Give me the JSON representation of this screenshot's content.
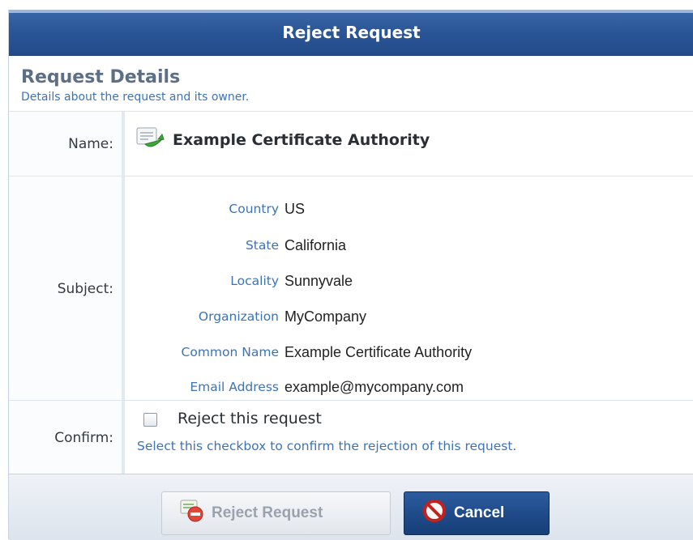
{
  "dialog": {
    "title": "Reject Request"
  },
  "section": {
    "title": "Request Details",
    "description": "Details about the request and its owner."
  },
  "name_row": {
    "label": "Name:",
    "icon": "certificate-icon",
    "value": "Example Certificate Authority"
  },
  "subject_row": {
    "label": "Subject:",
    "fields": [
      {
        "key": "Country",
        "value": "US"
      },
      {
        "key": "State",
        "value": "California"
      },
      {
        "key": "Locality",
        "value": "Sunnyvale"
      },
      {
        "key": "Organization",
        "value": "MyCompany"
      },
      {
        "key": "Common Name",
        "value": "Example Certificate Authority"
      },
      {
        "key": "Email Address",
        "value": "example@mycompany.com"
      }
    ]
  },
  "confirm_row": {
    "label": "Confirm:",
    "checkbox_label": "Reject this request",
    "checked": false,
    "help": "Select this checkbox to confirm the rejection of this request."
  },
  "buttons": {
    "reject": {
      "label": "Reject Request",
      "icon": "reject-certificate-icon",
      "enabled": false
    },
    "cancel": {
      "label": "Cancel",
      "icon": "cancel-icon",
      "enabled": true
    }
  },
  "colors": {
    "title_bar": "#2a5596",
    "link_blue": "#3d73b5",
    "section_title": "#5c6f85"
  }
}
